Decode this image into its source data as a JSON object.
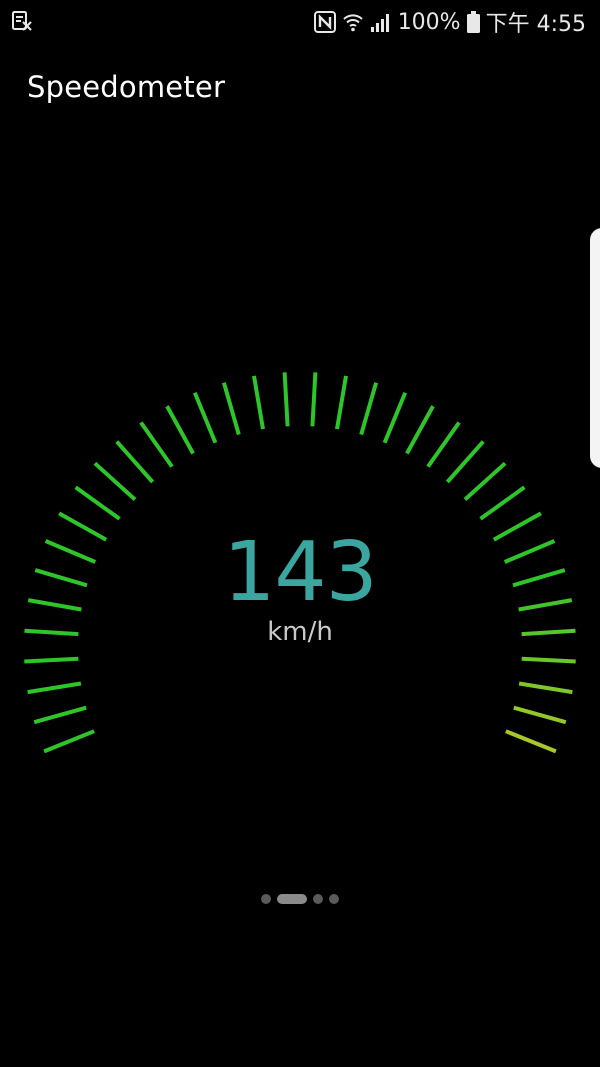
{
  "status_bar": {
    "battery_percent": "100%",
    "time": "下午 4:55",
    "icons": [
      "screenshot-notification-icon",
      "nfc-icon",
      "wifi-icon",
      "signal-icon",
      "battery-icon"
    ]
  },
  "app": {
    "title": "Speedometer"
  },
  "gauge": {
    "speed_value": "143",
    "unit": "km/h",
    "tick_count": 36,
    "colors": {
      "tick_green": "#2ec52a",
      "tick_yellow": "#a7c72a",
      "speed_text": "#3ba6a0"
    }
  },
  "pager": {
    "page_count": 4,
    "active_page": 2
  }
}
